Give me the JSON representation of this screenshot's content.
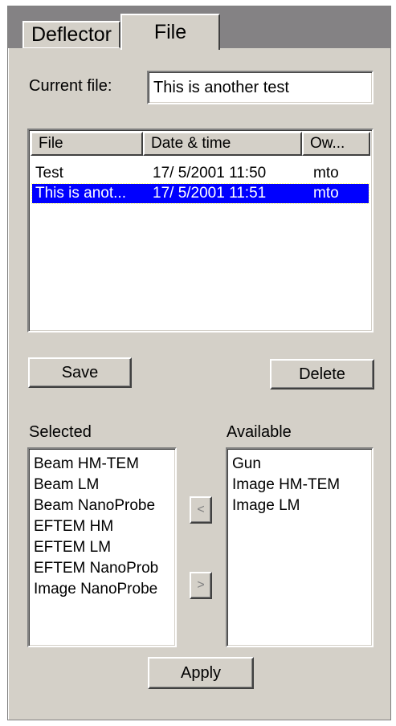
{
  "tabs": [
    {
      "label": "Deflector",
      "active": false
    },
    {
      "label": "File",
      "active": true
    }
  ],
  "current_file": {
    "label": "Current file:",
    "value": "This is another test"
  },
  "file_table": {
    "columns": [
      "File",
      "Date & time",
      "Ow..."
    ],
    "rows": [
      {
        "file": "Test",
        "datetime": "17/ 5/2001 11:50",
        "owner": "mto",
        "selected": false
      },
      {
        "file": "This is anot...",
        "datetime": "17/ 5/2001 11:51",
        "owner": "mto",
        "selected": true
      }
    ]
  },
  "buttons": {
    "save": "Save",
    "delete": "Delete",
    "move_left": "<",
    "move_right": ">",
    "apply": "Apply"
  },
  "selected_list": {
    "label": "Selected",
    "items": [
      "Beam HM-TEM",
      "Beam LM",
      "Beam NanoProbe",
      "EFTEM HM",
      "EFTEM LM",
      "EFTEM NanoProb",
      "Image NanoProbe"
    ]
  },
  "available_list": {
    "label": "Available",
    "items": [
      "Gun",
      "Image HM-TEM",
      "Image LM"
    ]
  }
}
